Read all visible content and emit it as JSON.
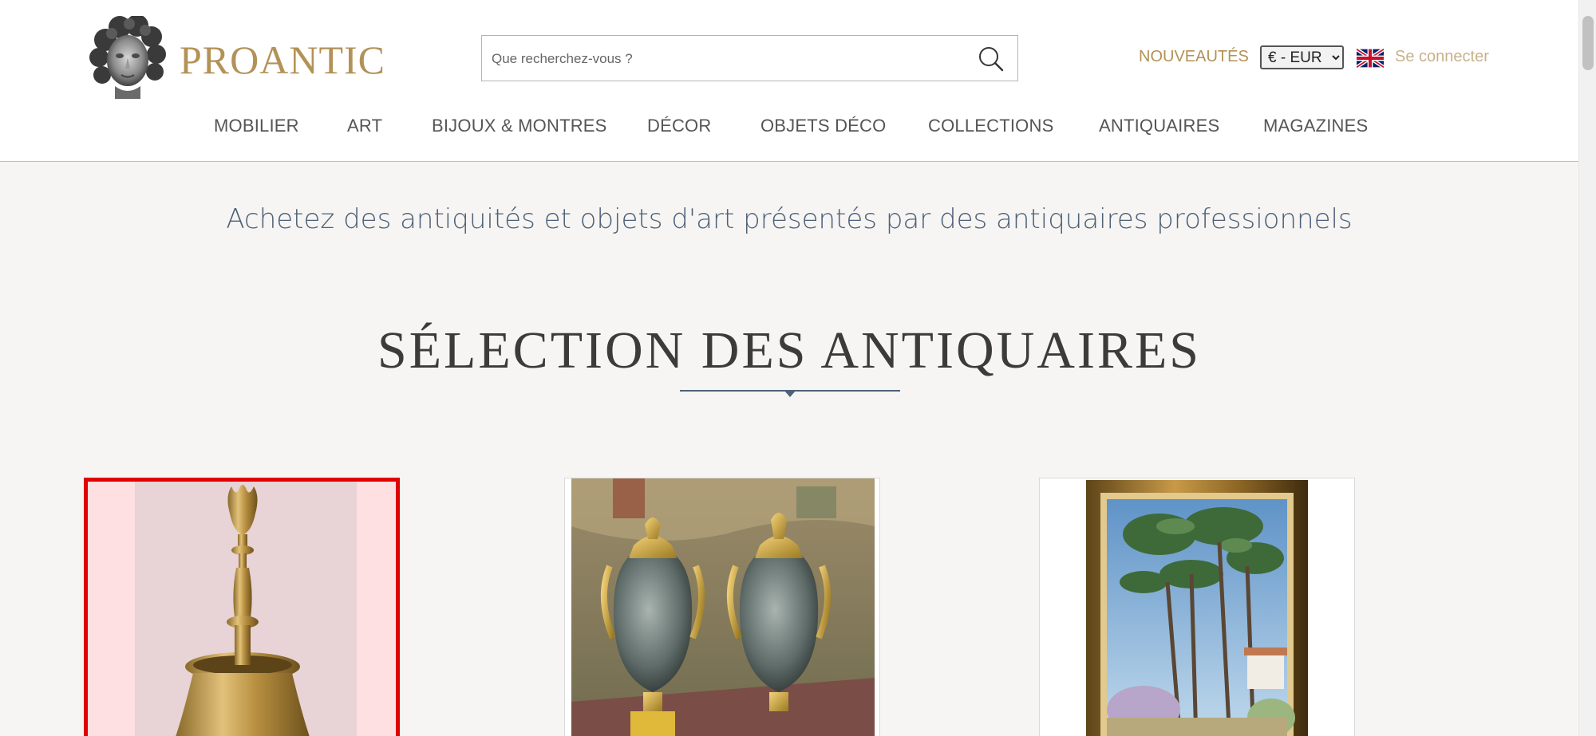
{
  "site": {
    "logo_text": "PROANTIC"
  },
  "search": {
    "placeholder": "Que recherchez-vous ?"
  },
  "header": {
    "new_label": "NOUVEAUTÉS",
    "currency_selected": "€ - EUR",
    "login_label": "Se connecter"
  },
  "nav": {
    "items": [
      {
        "label": "MOBILIER"
      },
      {
        "label": "ART"
      },
      {
        "label": "BIJOUX & MONTRES"
      },
      {
        "label": "DÉCOR"
      },
      {
        "label": "OBJETS DÉCO"
      },
      {
        "label": "COLLECTIONS"
      },
      {
        "label": "ANTIQUAIRES"
      },
      {
        "label": "MAGAZINES"
      }
    ]
  },
  "main": {
    "tagline": "Achetez des antiquités et objets d'art présentés par des antiquaires professionnels",
    "section_title": "SÉLECTION DES ANTIQUAIRES"
  },
  "products": [
    {
      "name": "brass-candlestick",
      "selected": true
    },
    {
      "name": "marble-ormolu-vases",
      "selected": false
    },
    {
      "name": "framed-landscape-painting",
      "selected": false
    }
  ],
  "colors": {
    "brand_gold": "#b39257",
    "login_gold": "#c9b18a",
    "tagline_blue": "#4e6178",
    "selection_red": "#e00000"
  }
}
